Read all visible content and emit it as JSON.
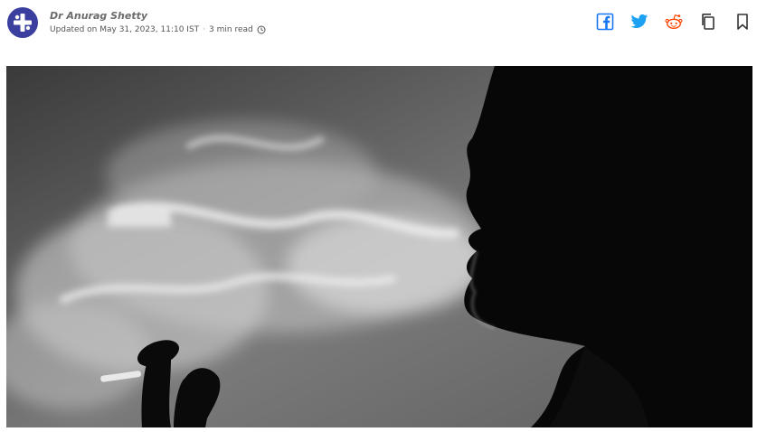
{
  "article": {
    "author": "Dr Anurag Shetty",
    "updated": "Updated on May 31, 2023, 11:10 IST",
    "separator": "·",
    "read_time": "3 min read"
  },
  "share": {
    "icons": [
      "facebook-icon",
      "twitter-icon",
      "reddit-icon",
      "copy-icon",
      "bookmark-icon"
    ],
    "colors": {
      "facebook": "#1877f2",
      "twitter": "#1da1f2",
      "reddit": "#ff4500",
      "neutral": "#333333"
    }
  },
  "brand": {
    "avatar_color": "#3b3f9e"
  }
}
